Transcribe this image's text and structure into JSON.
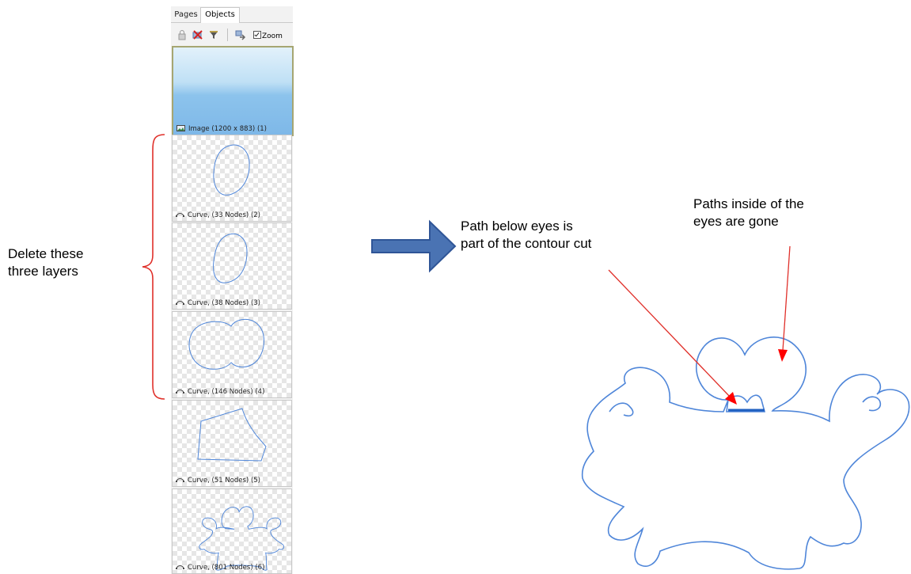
{
  "panel": {
    "tabs": [
      "Pages",
      "Objects"
    ],
    "active_tab": "Objects",
    "toolbar": {
      "icons": [
        "lock-icon",
        "delete-icon",
        "filter-icon",
        "move-icon"
      ],
      "zoom_label": "Zoom",
      "zoom_checked": true
    },
    "layers": [
      {
        "label": "Image (1200 x 883) (1)",
        "kind": "image-icon"
      },
      {
        "label": "Curve, (33 Nodes) (2)",
        "kind": "curve-icon"
      },
      {
        "label": "Curve, (38 Nodes) (3)",
        "kind": "curve-icon"
      },
      {
        "label": "Curve, (146 Nodes) (4)",
        "kind": "curve-icon"
      },
      {
        "label": "Curve, (51 Nodes) (5)",
        "kind": "curve-icon"
      },
      {
        "label": "Curve, (801 Nodes) (6)",
        "kind": "curve-icon"
      }
    ]
  },
  "annotations": {
    "delete_note": [
      "Delete these",
      "three layers"
    ],
    "path_below_note": [
      "Path below eyes is",
      "part of the contour cut"
    ],
    "paths_inside_note": [
      "Paths inside of the",
      "eyes are gone"
    ]
  },
  "colors": {
    "path_blue": "#4f86d9",
    "bracket_red": "#e0302a",
    "arrow_fill": "#4a73b3",
    "arrow_stroke": "#2f5597",
    "annotation_red": "#ff0000"
  }
}
